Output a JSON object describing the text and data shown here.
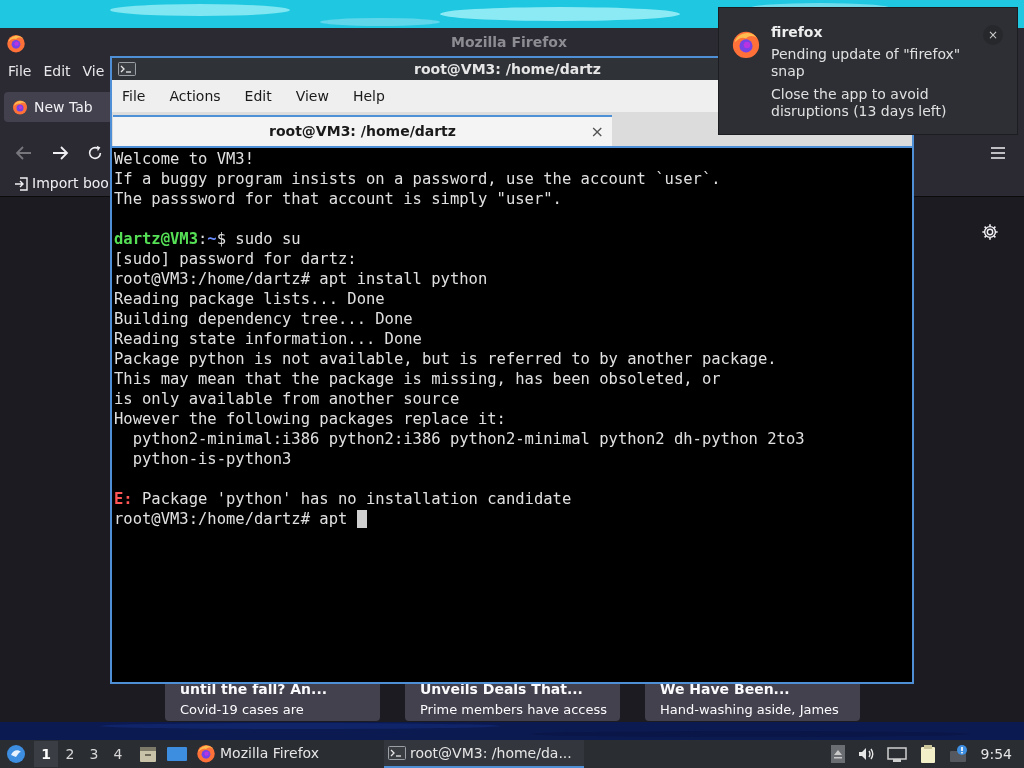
{
  "firefox_window": {
    "title": "Mozilla Firefox",
    "menu": [
      "File",
      "Edit",
      "Vie"
    ],
    "tabs": [
      {
        "label": "New Tab",
        "selected": true
      }
    ],
    "bookmarks": [
      {
        "label": "Import boo"
      }
    ],
    "cards": [
      {
        "title": "until the fall? An...",
        "snippet": "Covid-19 cases are"
      },
      {
        "title": "Unveils Deals That...",
        "snippet": "Prime members have access"
      },
      {
        "title": "We Have Been...",
        "snippet": "Hand-washing aside, James"
      }
    ]
  },
  "terminal_window": {
    "title": "root@VM3: /home/dartz",
    "menu": [
      "File",
      "Actions",
      "Edit",
      "View",
      "Help"
    ],
    "tabs": [
      {
        "label": "root@VM3: /home/dartz",
        "selected": true,
        "close": "×"
      }
    ],
    "blocks": [
      {
        "lines": [
          {
            "segments": [
              {
                "kind": "plain",
                "text": "Welcome to VM3!"
              }
            ]
          },
          {
            "segments": [
              {
                "kind": "plain",
                "text": "If a buggy program insists on a password, use the account `user`."
              }
            ]
          },
          {
            "segments": [
              {
                "kind": "plain",
                "text": "The passsword for that account is simply \"user\"."
              }
            ]
          }
        ]
      },
      {
        "lines": [
          {
            "segments": [
              {
                "kind": "user",
                "text": "dartz@VM3"
              },
              {
                "kind": "plain",
                "text": ":"
              },
              {
                "kind": "path",
                "text": "~"
              },
              {
                "kind": "plain",
                "text": "$ sudo su"
              }
            ]
          },
          {
            "segments": [
              {
                "kind": "plain",
                "text": "[sudo] password for dartz:"
              }
            ]
          },
          {
            "segments": [
              {
                "kind": "plain",
                "text": "root@VM3:/home/dartz# apt install python"
              }
            ]
          },
          {
            "segments": [
              {
                "kind": "plain",
                "text": "Reading package lists... Done"
              }
            ]
          },
          {
            "segments": [
              {
                "kind": "plain",
                "text": "Building dependency tree... Done"
              }
            ]
          },
          {
            "segments": [
              {
                "kind": "plain",
                "text": "Reading state information... Done"
              }
            ]
          },
          {
            "segments": [
              {
                "kind": "plain",
                "text": "Package python is not available, but is referred to by another package."
              }
            ]
          },
          {
            "segments": [
              {
                "kind": "plain",
                "text": "This may mean that the package is missing, has been obsoleted, or"
              }
            ]
          },
          {
            "segments": [
              {
                "kind": "plain",
                "text": "is only available from another source"
              }
            ]
          },
          {
            "segments": [
              {
                "kind": "plain",
                "text": "However the following packages replace it:"
              }
            ]
          },
          {
            "segments": [
              {
                "kind": "plain",
                "text": "  python2-minimal:i386 python2:i386 python2-minimal python2 dh-python 2to3"
              }
            ]
          },
          {
            "segments": [
              {
                "kind": "plain",
                "text": "  python-is-python3"
              }
            ]
          }
        ]
      },
      {
        "lines": [
          {
            "segments": [
              {
                "kind": "error",
                "text": "E:"
              },
              {
                "kind": "plain",
                "text": " Package 'python' has no installation candidate"
              }
            ]
          },
          {
            "segments": [
              {
                "kind": "plain",
                "text": "root@VM3:/home/dartz# apt "
              }
            ],
            "cursor": true
          }
        ]
      }
    ]
  },
  "notification": {
    "app": "firefox",
    "message": "Pending update of \"firefox\" snap",
    "detail": "Close the app to avoid disruptions (13 days left)",
    "close": "×"
  },
  "taskbar": {
    "workspaces": [
      {
        "label": "1",
        "selected": true
      },
      {
        "label": "2",
        "selected": false
      },
      {
        "label": "3",
        "selected": false
      },
      {
        "label": "4",
        "selected": false
      }
    ],
    "tasks": [
      {
        "kind": "firefox",
        "label": "Mozilla Firefox",
        "selected": false
      },
      {
        "kind": "terminal",
        "label": "root@VM3: /home/da...",
        "selected": true
      }
    ],
    "clock": "9:54"
  }
}
